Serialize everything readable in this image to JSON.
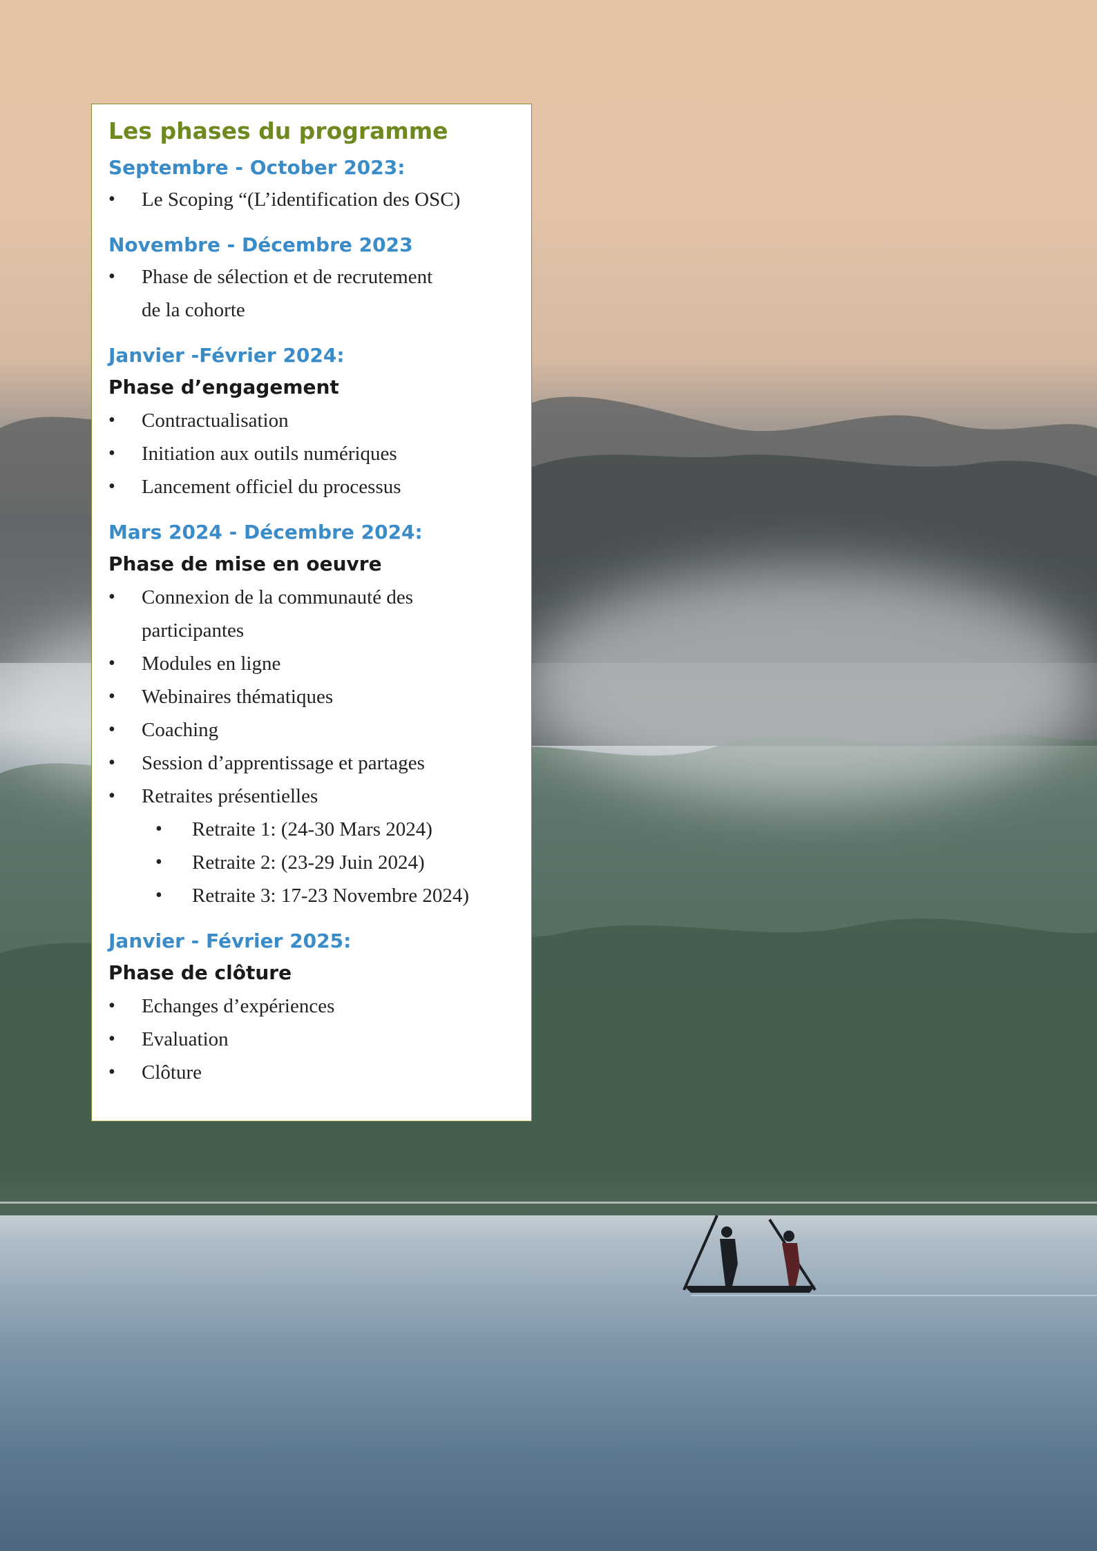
{
  "title": "Les phases du programme",
  "sections": [
    {
      "date": "Septembre - October 2023:",
      "items": [
        "Le Scoping “(L’identification des OSC)"
      ]
    },
    {
      "date": "Novembre - Décembre 2023",
      "items": [
        "Phase de sélection et de recrutement",
        "de la cohorte"
      ]
    },
    {
      "date": "Janvier -Février 2024:",
      "phase": "Phase d’engagement",
      "items": [
        "Contractualisation",
        "Initiation aux outils numériques",
        "Lancement officiel du processus"
      ]
    },
    {
      "date": "Mars 2024 - Décembre 2024:",
      "phase": "Phase de mise en oeuvre",
      "items": [
        "Connexion de la communauté des",
        "participantes",
        "Modules en ligne",
        "Webinaires thématiques",
        "Coaching",
        "Session d’apprentissage et partages",
        "Retraites présentielles"
      ],
      "subitems": [
        "Retraite 1: (24-30 Mars 2024)",
        "Retraite 2: (23-29 Juin 2024)",
        "Retraite 3: 17-23 Novembre 2024)"
      ]
    },
    {
      "date": "Janvier - Février  2025:",
      "phase": "Phase de clôture",
      "items": [
        "Echanges d’expériences",
        "Evaluation",
        "Clôture"
      ]
    }
  ],
  "colors": {
    "title": "#6e8a1f",
    "date": "#3a8cc8",
    "phase": "#1a1a1a",
    "panel_border": "#7b8f2e"
  }
}
